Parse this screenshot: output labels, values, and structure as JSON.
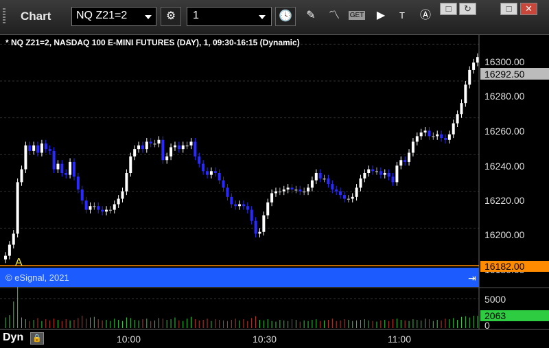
{
  "window": {
    "title": "Chart"
  },
  "toolbar": {
    "symbol": "NQ Z21=2",
    "interval": "1",
    "get_label": "GET",
    "icons": [
      "gear-icon",
      "clock-icon",
      "pencil-icon",
      "studies-icon",
      "get-data-icon",
      "play-icon",
      "text-tool-icon",
      "alert-icon"
    ]
  },
  "window_controls": {
    "restore_label": "□",
    "refresh_label": "↻",
    "maximize_label": "□",
    "close_label": "✕"
  },
  "chart": {
    "caption": "* NQ Z21=2, NASDAQ 100 E-MINI FUTURES (DAY), 1, 09:30-16:15 (Dynamic)",
    "marker_label": "A",
    "copyright": "© eSignal, 2021",
    "dyn_label": "Dyn",
    "price_labels": [
      "16300.00",
      "16280.00",
      "16260.00",
      "16240.00",
      "16220.00",
      "16200.00"
    ],
    "last_price": "16292.50",
    "line_price": "16182.00",
    "line_price_behind": "16180.00",
    "volume_labels": [
      "5000",
      "0"
    ],
    "last_volume": "2063",
    "time_labels": [
      "10:00",
      "10:30",
      "11:00"
    ],
    "colors": {
      "up": "#ffffff",
      "down": "#2a2aff",
      "neutral": "#aaaaaa",
      "line": "#ff8c00",
      "vol_up": "#2ecc40",
      "vol_down": "#c0392b",
      "band": "#1c5cff"
    }
  },
  "chart_data": {
    "type": "candlestick",
    "ylim": [
      16180,
      16305
    ],
    "closes": [
      16185,
      16191,
      16197,
      16225,
      16232,
      16245,
      16242,
      16245,
      16241,
      16246,
      16243,
      16242,
      16232,
      16235,
      16230,
      16229,
      16236,
      16228,
      16221,
      16215,
      16210,
      16212,
      16212,
      16210,
      16209,
      16210,
      16210,
      16213,
      16216,
      16220,
      16230,
      16239,
      16243,
      16245,
      16243,
      16247,
      16246,
      16246,
      16248,
      16237,
      16239,
      16244,
      16245,
      16243,
      16245,
      16245,
      16247,
      16239,
      16235,
      16231,
      16229,
      16231,
      16230,
      16226,
      16222,
      16217,
      16213,
      16212,
      16213,
      16212,
      16210,
      16204,
      16197,
      16198,
      16207,
      16214,
      16219,
      16220,
      16220,
      16221,
      16222,
      16221,
      16221,
      16220,
      16220,
      16222,
      16226,
      16230,
      16227,
      16227,
      16224,
      16221,
      16220,
      16218,
      16216,
      16216,
      16217,
      16222,
      16227,
      16230,
      16232,
      16231,
      16231,
      16229,
      16230,
      16228,
      16225,
      16234,
      16237,
      16236,
      16241,
      16247,
      16250,
      16252,
      16253,
      16250,
      16250,
      16251,
      16249,
      16248,
      16251,
      16257,
      16262,
      16268,
      16278,
      16286,
      16290,
      16293
    ],
    "volumes": [
      1800,
      2200,
      4500,
      7000,
      1800,
      1500,
      1200,
      1400,
      1700,
      1200,
      1500,
      1300,
      1600,
      1400,
      1200,
      1500,
      1300,
      1400,
      1700,
      2100,
      1600,
      1800,
      1900,
      1500,
      1300,
      1400,
      1200,
      1600,
      1400,
      1200,
      1800,
      1700,
      1400,
      1300,
      1500,
      1600,
      1200,
      1300,
      1700,
      1600,
      1400,
      1500,
      1800,
      1300,
      1200,
      1600,
      1900,
      1500,
      1300,
      1400,
      1600,
      1200,
      1500,
      1400,
      1300,
      1200,
      1400,
      1600,
      1300,
      1500,
      1200,
      1700,
      2000,
      1400,
      1300,
      1500,
      1200,
      1100,
      1400,
      1300,
      1200,
      1500,
      1400,
      1100,
      1300,
      1200,
      1400,
      1500,
      1200,
      1300,
      1400,
      1600,
      1200,
      1300,
      1500,
      1400,
      1200,
      1300,
      1400,
      1500,
      1300,
      1200,
      1100,
      1300,
      1400,
      1200,
      1500,
      1600,
      1400,
      1300,
      1200,
      1500,
      1400,
      1300,
      1600,
      1500,
      1200,
      1400,
      1300,
      1600,
      1500,
      1700,
      1400,
      1900,
      2000,
      1800,
      2100,
      2063
    ]
  }
}
